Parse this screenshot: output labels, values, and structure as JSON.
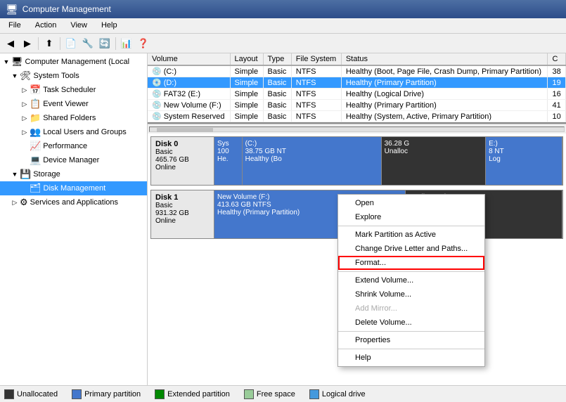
{
  "title_bar": {
    "icon": "🖥",
    "title": "Computer Management"
  },
  "menu_bar": {
    "items": [
      "File",
      "Action",
      "View",
      "Help"
    ]
  },
  "toolbar": {
    "buttons": [
      "◀",
      "▶",
      "⬆",
      "📄",
      "🔧",
      "📋",
      "❌",
      "🔍",
      "🔎",
      "📊"
    ]
  },
  "sidebar": {
    "root_label": "Computer Management (Local",
    "items": [
      {
        "id": "system-tools",
        "label": "System Tools",
        "indent": 1,
        "expanded": true,
        "icon": "🛠"
      },
      {
        "id": "task-scheduler",
        "label": "Task Scheduler",
        "indent": 2,
        "expanded": false,
        "icon": "📅"
      },
      {
        "id": "event-viewer",
        "label": "Event Viewer",
        "indent": 2,
        "expanded": false,
        "icon": "📋"
      },
      {
        "id": "shared-folders",
        "label": "Shared Folders",
        "indent": 2,
        "expanded": false,
        "icon": "📁"
      },
      {
        "id": "local-users",
        "label": "Local Users and Groups",
        "indent": 2,
        "expanded": false,
        "icon": "👥"
      },
      {
        "id": "performance",
        "label": "Performance",
        "indent": 2,
        "expanded": false,
        "icon": "📈"
      },
      {
        "id": "device-manager",
        "label": "Device Manager",
        "indent": 2,
        "expanded": false,
        "icon": "💻"
      },
      {
        "id": "storage",
        "label": "Storage",
        "indent": 1,
        "expanded": true,
        "icon": "💾"
      },
      {
        "id": "disk-management",
        "label": "Disk Management",
        "indent": 2,
        "expanded": false,
        "icon": "🗂",
        "selected": true
      },
      {
        "id": "services-apps",
        "label": "Services and Applications",
        "indent": 1,
        "expanded": false,
        "icon": "⚙"
      }
    ]
  },
  "table": {
    "columns": [
      "Volume",
      "Layout",
      "Type",
      "File System",
      "Status",
      "C"
    ],
    "rows": [
      {
        "icon": "💿",
        "volume": "(C:)",
        "layout": "Simple",
        "type": "Basic",
        "fs": "NTFS",
        "status": "Healthy (Boot, Page File, Crash Dump, Primary Partition)",
        "cap": "38"
      },
      {
        "icon": "💿",
        "volume": "(D:)",
        "layout": "Simple",
        "type": "Basic",
        "fs": "NTFS",
        "status": "Healthy (Primary Partition)",
        "cap": "19",
        "selected": true
      },
      {
        "icon": "💿",
        "volume": "FAT32 (E:)",
        "layout": "Simple",
        "type": "Basic",
        "fs": "NTFS",
        "status": "Healthy (Logical Drive)",
        "cap": "16"
      },
      {
        "icon": "💿",
        "volume": "New Volume (F:)",
        "layout": "Simple",
        "type": "Basic",
        "fs": "NTFS",
        "status": "Healthy (Primary Partition)",
        "cap": "41"
      },
      {
        "icon": "💿",
        "volume": "System Reserved",
        "layout": "Simple",
        "type": "Basic",
        "fs": "NTFS",
        "status": "Healthy (System, Active, Primary Partition)",
        "cap": "10"
      }
    ]
  },
  "disks": [
    {
      "id": "disk0",
      "label": "Disk 0",
      "type": "Basic",
      "size": "465.76 GB",
      "status": "Online",
      "partitions": [
        {
          "label": "Sys\n100\nHe.",
          "size_label": "Sys",
          "color": "sys-color",
          "width_pct": 8
        },
        {
          "label": "(C:)\n38.75 GB NT\nHealthy (Bo",
          "color": "primary-color",
          "width_pct": 40
        },
        {
          "label": "36.28 G\nUnalloc",
          "color": "unallocated-color",
          "width_pct": 30
        },
        {
          "label": "E:)\n8 NT\nLog",
          "color": "right-area",
          "width_pct": 22
        }
      ]
    },
    {
      "id": "disk1",
      "label": "Disk 1",
      "type": "Basic",
      "size": "931.32 GB",
      "status": "Online",
      "partitions": [
        {
          "label": "New Volume (F:)\n413.63 GB NTFS\nHealthy (Primary Partition)",
          "color": "new-volume-color",
          "width_pct": 55
        },
        {
          "label": "Unallocated",
          "color": "unallocated-color",
          "width_pct": 45
        }
      ]
    }
  ],
  "context_menu": {
    "items": [
      {
        "id": "open",
        "label": "Open",
        "disabled": false
      },
      {
        "id": "explore",
        "label": "Explore",
        "disabled": false
      },
      {
        "id": "sep1",
        "type": "separator"
      },
      {
        "id": "mark-active",
        "label": "Mark Partition as Active",
        "disabled": false
      },
      {
        "id": "change-drive",
        "label": "Change Drive Letter and Paths...",
        "disabled": false
      },
      {
        "id": "format",
        "label": "Format...",
        "disabled": false,
        "highlighted": true
      },
      {
        "id": "sep2",
        "type": "separator"
      },
      {
        "id": "extend",
        "label": "Extend Volume...",
        "disabled": false
      },
      {
        "id": "shrink",
        "label": "Shrink Volume...",
        "disabled": false
      },
      {
        "id": "add-mirror",
        "label": "Add Mirror...",
        "disabled": true
      },
      {
        "id": "delete",
        "label": "Delete Volume...",
        "disabled": false
      },
      {
        "id": "sep3",
        "type": "separator"
      },
      {
        "id": "properties",
        "label": "Properties",
        "disabled": false
      },
      {
        "id": "sep4",
        "type": "separator"
      },
      {
        "id": "help",
        "label": "Help",
        "disabled": false
      }
    ]
  },
  "status_bar": {
    "legends": [
      {
        "id": "unallocated",
        "label": "Unallocated",
        "color": "#333333"
      },
      {
        "id": "primary",
        "label": "Primary partition",
        "color": "#4477cc"
      },
      {
        "id": "extended",
        "label": "Extended partition",
        "color": "#008800"
      },
      {
        "id": "free",
        "label": "Free space",
        "color": "#99cc99"
      },
      {
        "id": "logical",
        "label": "Logical drive",
        "color": "#4499dd"
      }
    ]
  }
}
